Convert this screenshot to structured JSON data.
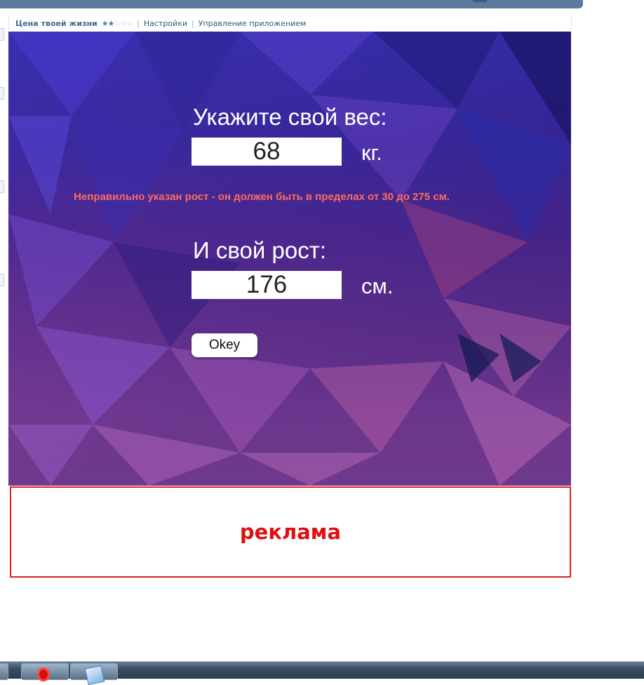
{
  "app_header": {
    "title": "Цена твоей жизни",
    "stars": "★★☆☆☆",
    "rating": 2,
    "rating_max": 5,
    "separator": "|",
    "settings_link": "Настройки",
    "manage_link": "Управление приложением"
  },
  "form": {
    "weight_label": "Укажите свой вес:",
    "weight_value": "68",
    "weight_unit": "кг.",
    "error_message": "Неправильно указан рост - он должен быть в пределах от 30 до 275 см.",
    "height_label": "И свой рост:",
    "height_value": "176",
    "height_unit": "см.",
    "ok_button": "Okey"
  },
  "ad": {
    "label": "реклама"
  },
  "taskbar": {
    "items": [
      "opera-browser-icon",
      "notepad-icon"
    ]
  },
  "colors": {
    "error": "#ff6b5f",
    "ad": "#e01010",
    "topbar": "#5b7aa0"
  }
}
